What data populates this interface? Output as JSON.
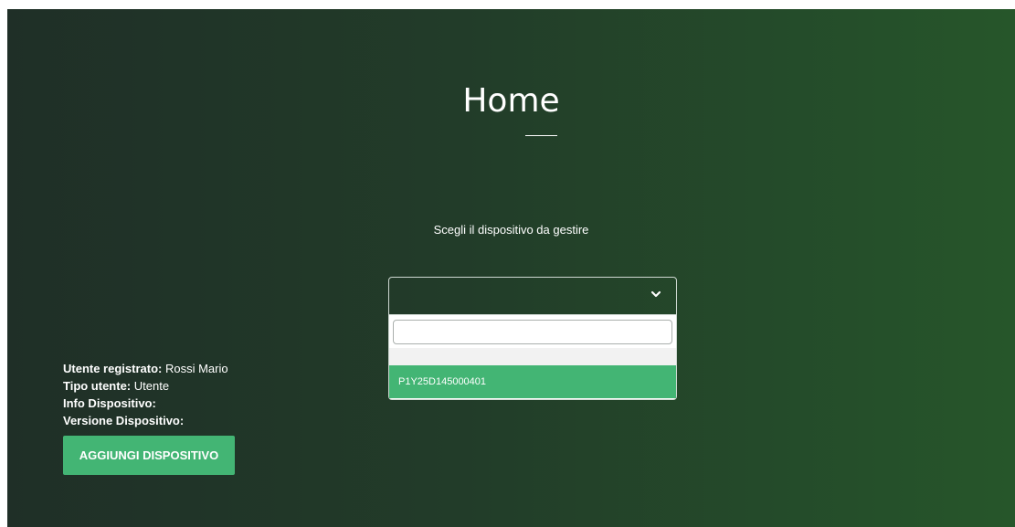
{
  "page": {
    "title": "Home",
    "choose_label": "Scegli il dispositivo da gestire"
  },
  "device_select": {
    "selected_value": "",
    "search_value": "",
    "options": [
      "",
      "P1Y25D145000401"
    ],
    "highlighted_option": "P1Y25D145000401",
    "icon": "chevron-down-icon"
  },
  "user_info": {
    "registered_user_label": "Utente registrato:",
    "registered_user_value": "Rossi Mario",
    "user_type_label": "Tipo utente:",
    "user_type_value": "Utente",
    "device_info_label": "Info Dispositivo:",
    "device_info_value": "",
    "device_version_label": "Versione Dispositivo:",
    "device_version_value": ""
  },
  "actions": {
    "add_device_label": "AGGIUNGI DISPOSITIVO"
  },
  "colors": {
    "accent": "#43b574",
    "background_start": "#1f2f27",
    "background_end": "#26562a"
  }
}
